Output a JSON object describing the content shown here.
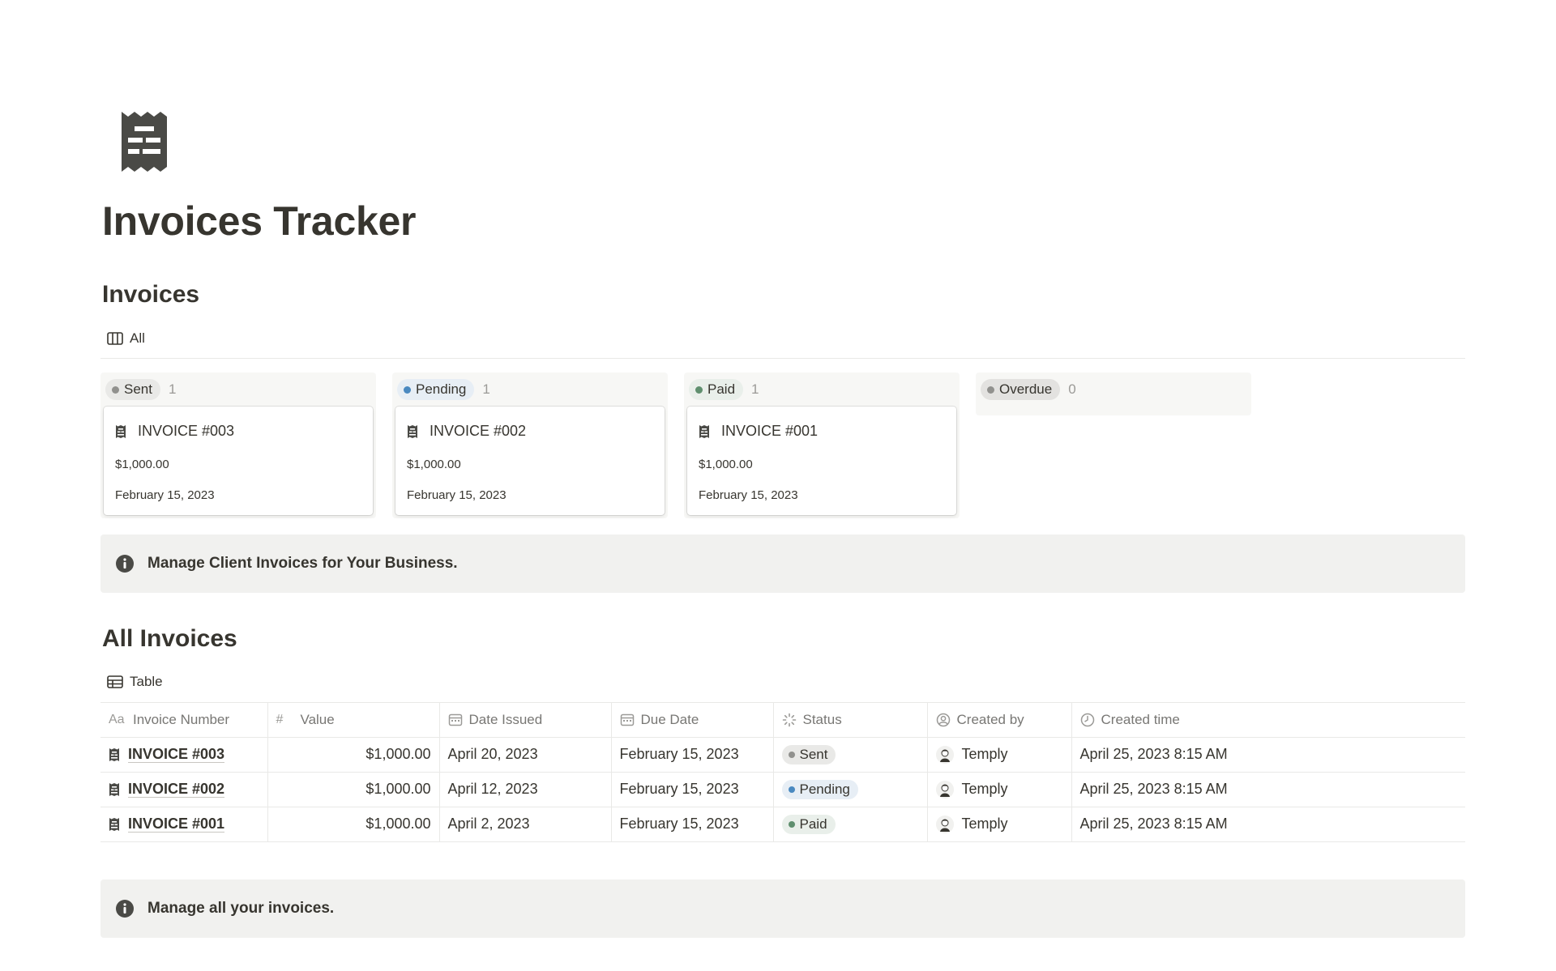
{
  "page": {
    "title": "Invoices Tracker",
    "icon": "receipt-icon"
  },
  "board": {
    "heading": "Invoices",
    "view_label": "All",
    "view_icon": "board-view-icon",
    "columns": [
      {
        "label": "Sent",
        "count": "1",
        "pill_bg": "#e9e9e7",
        "dot": "#91918e",
        "cards": [
          {
            "title": "INVOICE #003",
            "value": "$1,000.00",
            "date": "February 15, 2023"
          }
        ]
      },
      {
        "label": "Pending",
        "count": "1",
        "pill_bg": "#e7eef5",
        "dot": "#4a89c0",
        "cards": [
          {
            "title": "INVOICE #002",
            "value": "$1,000.00",
            "date": "February 15, 2023"
          }
        ]
      },
      {
        "label": "Paid",
        "count": "1",
        "pill_bg": "#e9efea",
        "dot": "#5f8f6e",
        "cards": [
          {
            "title": "INVOICE #001",
            "value": "$1,000.00",
            "date": "February 15, 2023"
          }
        ]
      },
      {
        "label": "Overdue",
        "count": "0",
        "pill_bg": "#e3e2e0",
        "dot": "#91918e",
        "cards": []
      }
    ]
  },
  "callout_top": {
    "text": "Manage Client Invoices for Your Business.",
    "icon": "info-icon"
  },
  "table": {
    "heading": "All Invoices",
    "view_label": "Table",
    "view_icon": "table-view-icon",
    "columns": {
      "name": {
        "label": "Invoice Number",
        "type_label": "Aa"
      },
      "value": {
        "label": "Value",
        "type_label": "#"
      },
      "issued": {
        "label": "Date Issued"
      },
      "due": {
        "label": "Due Date"
      },
      "status": {
        "label": "Status"
      },
      "created_by": {
        "label": "Created by"
      },
      "created_time": {
        "label": "Created time"
      }
    },
    "rows": [
      {
        "name": "INVOICE #003",
        "value": "$1,000.00",
        "issued": "April 20, 2023",
        "due": "February 15, 2023",
        "status": "Sent",
        "status_bg": "#e9e9e7",
        "status_dot": "#91918e",
        "created_by": "Temply",
        "created_time": "April 25, 2023 8:15 AM"
      },
      {
        "name": "INVOICE #002",
        "value": "$1,000.00",
        "issued": "April 12, 2023",
        "due": "February 15, 2023",
        "status": "Pending",
        "status_bg": "#e7eef5",
        "status_dot": "#4a89c0",
        "created_by": "Temply",
        "created_time": "April 25, 2023 8:15 AM"
      },
      {
        "name": "INVOICE #001",
        "value": "$1,000.00",
        "issued": "April 2, 2023",
        "due": "February 15, 2023",
        "status": "Paid",
        "status_bg": "#e9efea",
        "status_dot": "#5f8f6e",
        "created_by": "Temply",
        "created_time": "April 25, 2023 8:15 AM"
      }
    ]
  },
  "callout_bottom": {
    "text": "Manage all your invoices.",
    "icon": "info-icon"
  }
}
